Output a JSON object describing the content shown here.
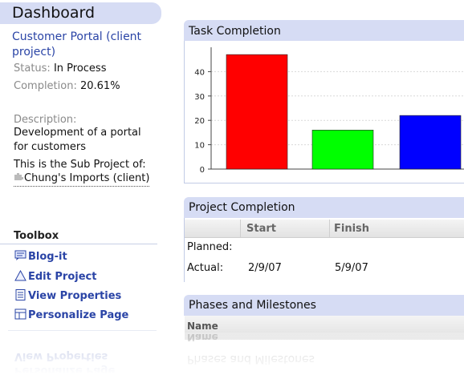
{
  "dashboard": {
    "title": "Dashboard",
    "project_name": "Customer Portal (client project)",
    "status_label": "Status:",
    "status_value": "In Process",
    "completion_label": "Completion:",
    "completion_value": "20.61%",
    "description_label": "Description:",
    "description_value": "Development of a portal for customers",
    "sub_project_text": "This is the Sub Project of:",
    "parent_project": "Chung's Imports (client)",
    "parent_icon": "puzzle-icon"
  },
  "toolbox": {
    "title": "Toolbox",
    "items": [
      {
        "label": "Blog-it",
        "icon": "blog-icon"
      },
      {
        "label": "Edit Project",
        "icon": "triangle-edit-icon"
      },
      {
        "label": "View Properties",
        "icon": "document-icon"
      },
      {
        "label": "Personalize Page",
        "icon": "layout-icon"
      }
    ]
  },
  "task_completion": {
    "title": "Task Completion",
    "chart_data": {
      "type": "bar",
      "title": "",
      "xlabel": "",
      "ylabel": "",
      "categories": [
        "",
        "",
        ""
      ],
      "values": [
        47,
        16,
        22
      ],
      "colors": [
        "#ff0000",
        "#00ff00",
        "#0000ff"
      ],
      "y_ticks": [
        0,
        10,
        20,
        30,
        40
      ],
      "ylim": [
        0,
        50
      ],
      "grid": true
    }
  },
  "project_completion": {
    "title": "Project Completion",
    "columns": [
      "Start",
      "Finish"
    ],
    "rows": [
      {
        "label": "Planned:",
        "start": "",
        "finish": ""
      },
      {
        "label": "Actual:",
        "start": "2/9/07",
        "finish": "5/9/07"
      }
    ]
  },
  "phases": {
    "title": "Phases and Milestones",
    "column_name": "Name"
  }
}
